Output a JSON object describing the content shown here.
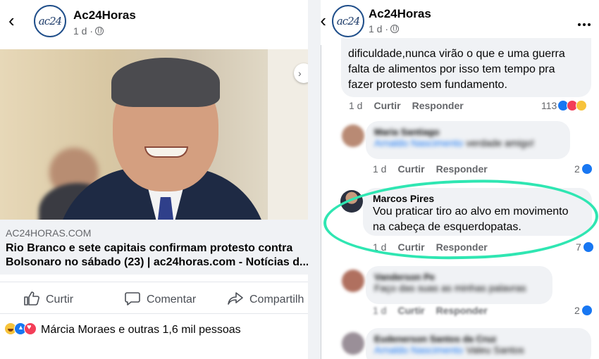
{
  "left": {
    "header": {
      "page_name": "Ac24Horas",
      "logo_text": "ac24",
      "time": "1 d ·",
      "back_icon": "chevron-left-icon"
    },
    "link": {
      "domain": "AC24HORAS.COM",
      "title_line1": "Rio Branco e sete capitais confirmam protesto contra",
      "title_line2": "Bolsonaro no sábado (23) | ac24horas.com - Notícias d..."
    },
    "actions": {
      "like": "Curtir",
      "comment": "Comentar",
      "share": "Compartilh"
    },
    "reactions": {
      "summary": "Márcia Moraes e outras 1,6 mil pessoas"
    }
  },
  "right": {
    "header": {
      "page_name": "Ac24Horas",
      "logo_text": "ac24",
      "time": "1 d ·"
    },
    "comment1": {
      "line1": "dificuldade,nunca virão o que e uma guerra",
      "line2": "falta de alimentos por isso tem tempo pra",
      "line3": "fazer protesto sem fundamento.",
      "time": "1 d",
      "like": "Curtir",
      "reply": "Responder",
      "count": "113"
    },
    "comment2": {
      "author": "Maria Santiago",
      "mention": "Arnaldo Nascimento",
      "text": "verdade amigo!",
      "time": "1 d",
      "like": "Curtir",
      "reply": "Responder",
      "count": "2"
    },
    "comment3": {
      "author": "Marcos Pires",
      "line1": "Vou praticar tiro ao alvo em movimento",
      "line2": "na cabeça de esquerdopatas.",
      "time": "1 d",
      "like": "Curtir",
      "reply": "Responder",
      "count": "7"
    },
    "comment4": {
      "author": "Vanderson Pe",
      "text": "Faço das suas as minhas palavras",
      "time": "1 d",
      "like": "Curtir",
      "reply": "Responder",
      "count": "2"
    },
    "comment5": {
      "author": "Eudenerson Santos da Cruz",
      "mention": "Arnaldo Nascimento",
      "text": "Valeu Santos"
    }
  },
  "colors": {
    "highlight_circle": "#2fe6b2",
    "like_blue": "#1877f2",
    "love_red": "#f33e58",
    "haha_yellow": "#f7c33b"
  }
}
